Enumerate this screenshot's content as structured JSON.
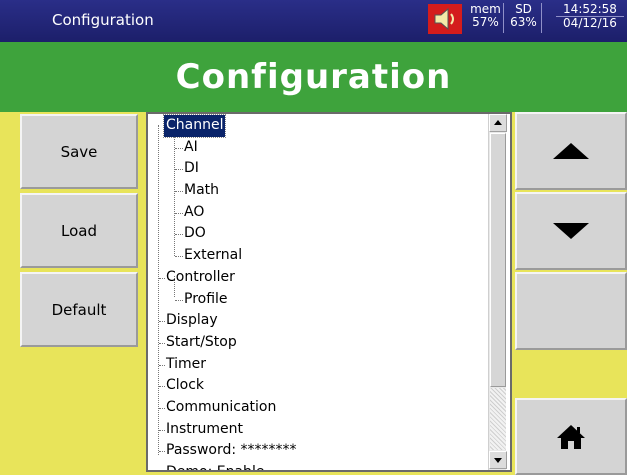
{
  "status_bar": {
    "title": "Configuration",
    "mem_label": "mem",
    "mem_value": "57%",
    "sd_label": "SD",
    "sd_value": "63%",
    "time": "14:52:58",
    "date": "04/12/16",
    "speaker_icon": "speaker-icon"
  },
  "header": {
    "title": "Configuration"
  },
  "left_buttons": {
    "save": "Save",
    "load": "Load",
    "default": "Default"
  },
  "right_buttons": {
    "up_icon": "up-arrow-icon",
    "down_icon": "down-arrow-icon",
    "home_icon": "home-icon"
  },
  "tree": {
    "items": [
      "Channel",
      "AI",
      "DI",
      "Math",
      "AO",
      "DO",
      "External",
      "Controller",
      "Profile",
      "Display",
      "Start/Stop",
      "Timer",
      "Clock",
      "Communication",
      "Instrument",
      "Password: ********",
      "Demo: Enable"
    ],
    "selected": "Channel"
  },
  "colors": {
    "status_bar": "#1c1f6a",
    "header": "#3ea33c",
    "background": "#e8e45a",
    "selection": "#0a246a"
  }
}
